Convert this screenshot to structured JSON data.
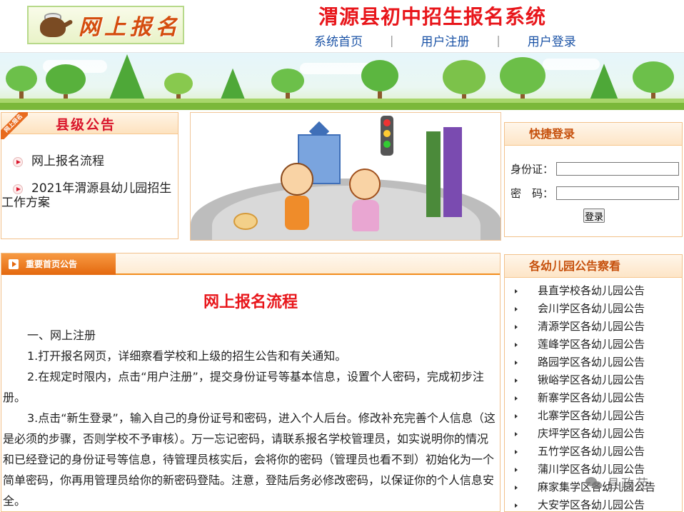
{
  "header": {
    "logo_text": "网上报名",
    "site_title": "渭源县初中招生报名系统",
    "nav": [
      {
        "label": "系统首页"
      },
      {
        "label": "用户注册"
      },
      {
        "label": "用户登录"
      }
    ],
    "nav_separator": "|"
  },
  "notice_box": {
    "ribbon": "网上报名",
    "title": "县级公告",
    "items": [
      {
        "label": "网上报名流程"
      },
      {
        "label": "2021年渭源县幼儿园招生工作方案"
      }
    ]
  },
  "login_box": {
    "title": "快捷登录",
    "id_label": "身份证：",
    "pwd_label": "密　码：",
    "id_value": "",
    "pwd_value": "",
    "button": "登录"
  },
  "main": {
    "tab_label": "重要首页公告",
    "article_title": "网上报名流程",
    "paragraphs": [
      "一、网上注册",
      "1.打开报名网页，详细察看学校和上级的招生公告和有关通知。",
      "2.在规定时限内，点击“用户注册”，提交身份证号等基本信息，设置个人密码，完成初步注册。",
      "3.点击“新生登录”，输入自己的身份证号和密码，进入个人后台。修改补充完善个人信息（这是必须的步骤，否则学校不予审核）。万一忘记密码，请联系报名学校管理员，如实说明你的情况和已经登记的身份证号等信息，待管理员核实后，会将你的密码（管理员也看不到）初始化为一个简单密码，你再用管理员给你的新密码登陆。注意，登陆后务必修改密码，以保证你的个人信息安全。"
    ]
  },
  "kindergarten_box": {
    "title": "各幼儿园公告察看",
    "items": [
      "县直学校各幼儿园公告",
      "会川学区各幼儿园公告",
      "清源学区各幼儿园公告",
      "莲峰学区各幼儿园公告",
      "路园学区各幼儿园公告",
      "锹峪学区各幼儿园公告",
      "新寨学区各幼儿园公告",
      "北寨学区各幼儿园公告",
      "庆坪学区各幼儿园公告",
      "五竹学区各幼儿园公告",
      "蒲川学区各幼儿园公告",
      "麻家集学区各幼儿园公告",
      "大安学区各幼儿园公告"
    ]
  },
  "watermark": {
    "text": "县政苑",
    "icon": "wechat-icon"
  },
  "colors": {
    "title_red": "#e8161b",
    "nav_blue": "#1b53a6",
    "box_border": "#f2c08a",
    "tab_orange": "#e4680e",
    "head_orange_text": "#c6500c"
  }
}
